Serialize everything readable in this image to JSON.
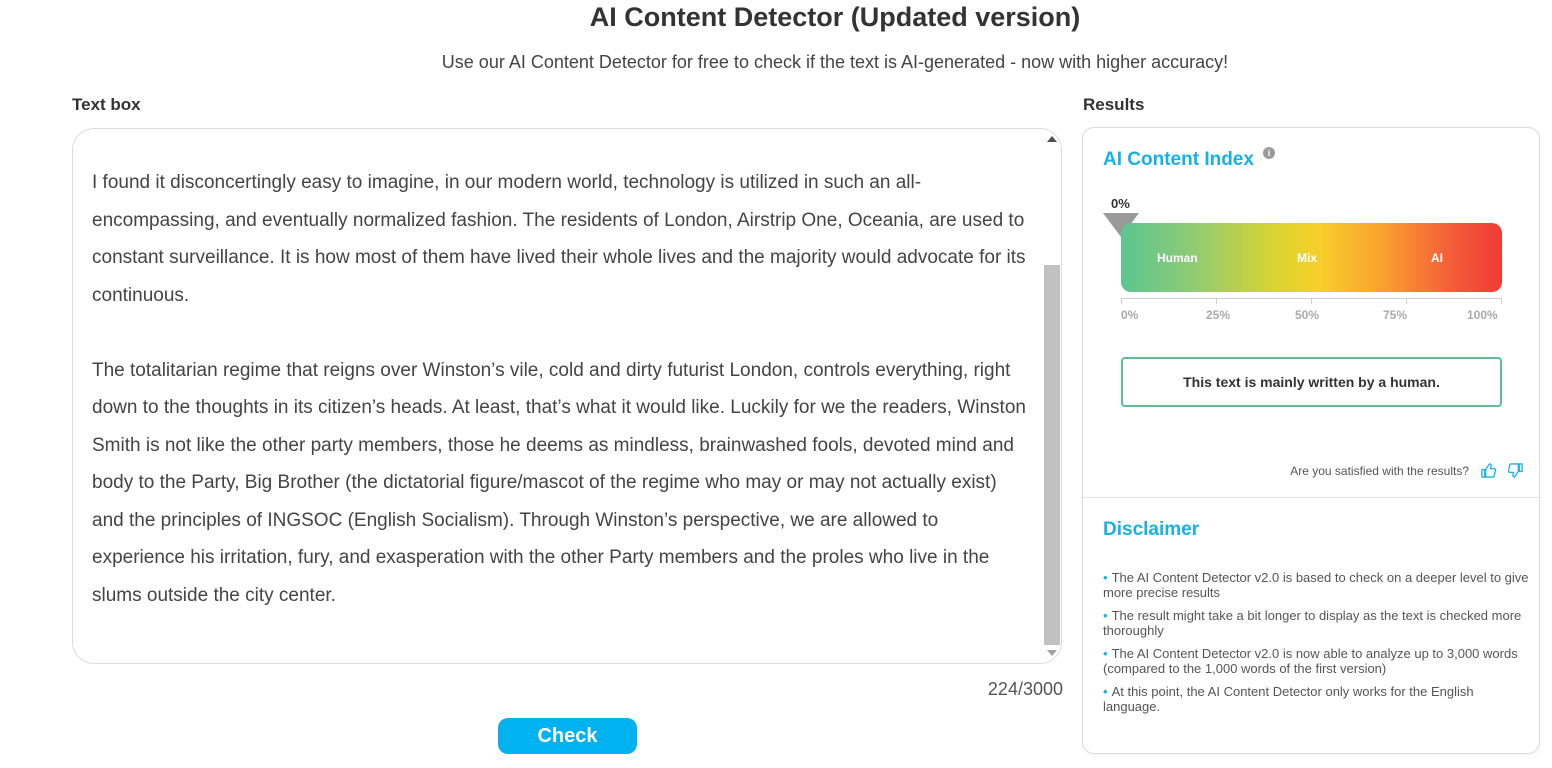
{
  "header": {
    "title": "AI Content Detector (Updated version)",
    "subtitle": "Use our AI Content Detector for free to check if the text is AI-generated - now with higher accuracy!"
  },
  "textbox": {
    "label": "Text box",
    "content": "I found it disconcertingly easy to imagine, in our modern world, technology is utilized in such an all-encompassing, and eventually normalized fashion. The residents of London, Airstrip One, Oceania, are used to constant surveillance. It is how most of them have lived their whole lives and the majority would advocate for its continuous.\n\nThe totalitarian regime that reigns over Winston’s vile, cold and dirty futurist London, controls everything, right down to the thoughts in its citizen’s heads. At least, that’s what it would like. Luckily for we the readers, Winston Smith is not like the other party members, those he deems as mindless, brainwashed fools, devoted mind and body to the Party, Big Brother (the dictatorial figure/mascot of the regime who may or may not actually exist) and the principles of INGSOC (English Socialism). Through Winston’s perspective, we are allowed to experience his irritation, fury, and exasperation with the other Party members and the proles who live in the slums outside the city center.",
    "char_count": "224/3000",
    "check_button": "Check"
  },
  "results": {
    "label": "Results",
    "index_title": "AI Content Index",
    "info_icon": "i",
    "pointer_value": "0%",
    "score": 0,
    "gauge_segments": [
      "Human",
      "Mix",
      "AI"
    ],
    "gauge_ticks": [
      "0%",
      "25%",
      "50%",
      "75%",
      "100%"
    ],
    "verdict": "This text is mainly written by a human.",
    "feedback_prompt": "Are you satisfied with the results?",
    "feedback_icons": [
      "thumbs-up-icon",
      "thumbs-down-icon"
    ]
  },
  "disclaimer": {
    "title": "Disclaimer",
    "items": [
      "The AI Content Detector v2.0 is based to check on a deeper level to give more precise results",
      "The result might take a bit longer to display as the text is checked more thoroughly",
      "The AI Content Detector v2.0 is now able to analyze up to 3,000 words (compared to the 1,000 words of the first version)",
      "At this point, the AI Content Detector only works for the English language."
    ],
    "bullet": "•"
  },
  "colors": {
    "accent": "#00b3f0",
    "human": "#5cc590",
    "mix": "#f7cf2a",
    "ai": "#ef3c34",
    "verdict_border": "#5cbf94"
  }
}
